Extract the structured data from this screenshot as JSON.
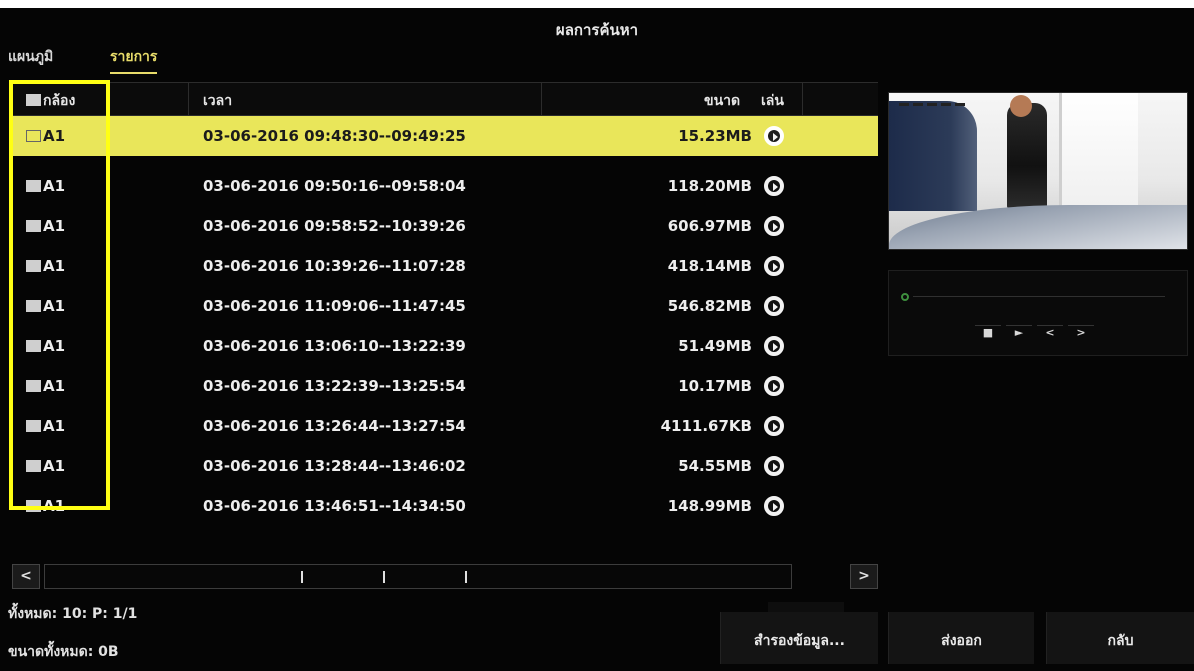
{
  "title": "ผลการค้นหา",
  "tabs": [
    {
      "label": "แผนภูมิ",
      "active": false
    },
    {
      "label": "รายการ",
      "active": true
    }
  ],
  "columns": {
    "camera": "กล้อง",
    "time": "เวลา",
    "size": "ขนาด",
    "play": "เล่น"
  },
  "rows": [
    {
      "camera": "A1",
      "time": "03-06-2016 09:48:30--09:49:25",
      "size": "15.23MB",
      "selected": true
    },
    {
      "camera": "A1",
      "time": "03-06-2016 09:50:16--09:58:04",
      "size": "118.20MB",
      "selected": false
    },
    {
      "camera": "A1",
      "time": "03-06-2016 09:58:52--10:39:26",
      "size": "606.97MB",
      "selected": false
    },
    {
      "camera": "A1",
      "time": "03-06-2016 10:39:26--11:07:28",
      "size": "418.14MB",
      "selected": false
    },
    {
      "camera": "A1",
      "time": "03-06-2016 11:09:06--11:47:45",
      "size": "546.82MB",
      "selected": false
    },
    {
      "camera": "A1",
      "time": "03-06-2016 13:06:10--13:22:39",
      "size": "51.49MB",
      "selected": false
    },
    {
      "camera": "A1",
      "time": "03-06-2016 13:22:39--13:25:54",
      "size": "10.17MB",
      "selected": false
    },
    {
      "camera": "A1",
      "time": "03-06-2016 13:26:44--13:27:54",
      "size": "4111.67KB",
      "selected": false
    },
    {
      "camera": "A1",
      "time": "03-06-2016 13:28:44--13:46:02",
      "size": "54.55MB",
      "selected": false
    },
    {
      "camera": "A1",
      "time": "03-06-2016 13:46:51--14:34:50",
      "size": "148.99MB",
      "selected": false
    }
  ],
  "scrollbar": {
    "left": "<",
    "right": ">"
  },
  "footer": {
    "total": "ทั้งหมด: 10: P: 1/1",
    "total_size": "ขนาดทั้งหมด: 0B"
  },
  "buttons": {
    "backup": "สำรองข้อมูล...",
    "export": "ส่งออก",
    "back": "กลับ"
  },
  "playback_controls": [
    "■",
    "►",
    "<",
    ">"
  ],
  "colors": {
    "selected_row": "#e9e65a",
    "highlight_box": "#ffff14",
    "active_tab": "#e8dc6a",
    "background": "#050505"
  }
}
